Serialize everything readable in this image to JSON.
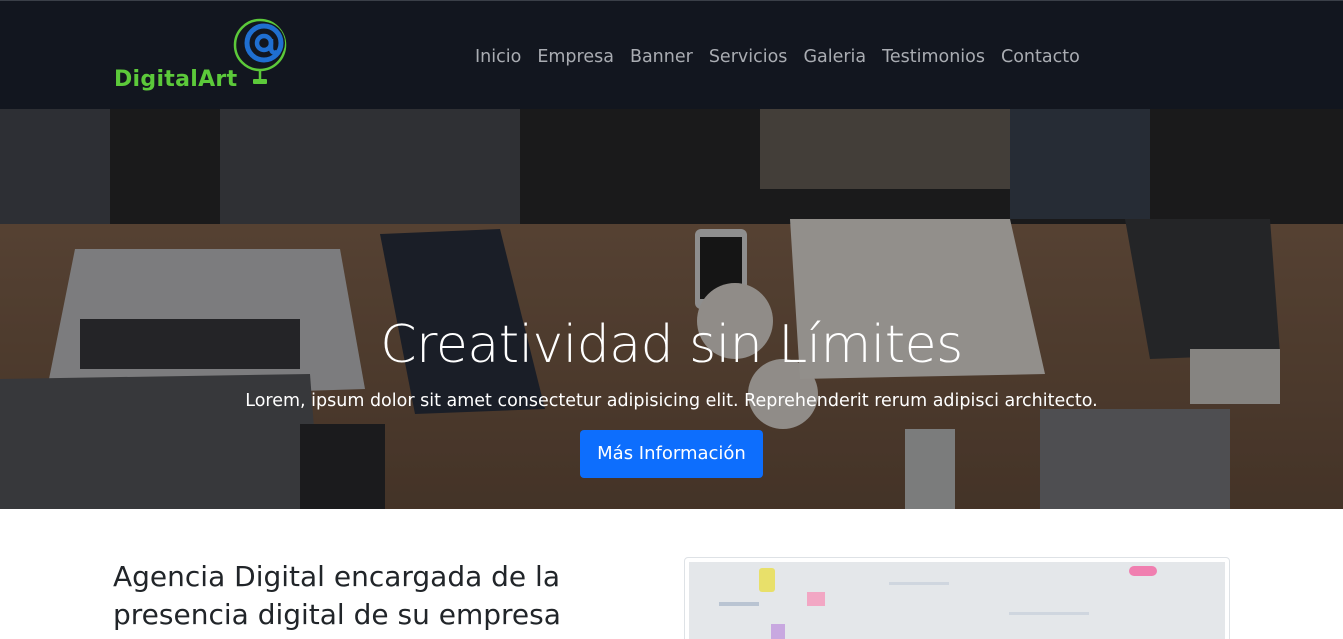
{
  "brand": {
    "name": "DigitalArt"
  },
  "nav": {
    "items": [
      "Inicio",
      "Empresa",
      "Banner",
      "Servicios",
      "Galeria",
      "Testimonios",
      "Contacto"
    ]
  },
  "hero": {
    "title": "Creatividad sin Límites",
    "subtitle": "Lorem, ipsum dolor sit amet consectetur adipisicing elit. Reprehenderit rerum adipisci architecto.",
    "button_label": "Más Información"
  },
  "about": {
    "title": "Agencia Digital encargada de la presencia digital de su empresa"
  },
  "colors": {
    "navbar_bg": "#12161f",
    "brand_green": "#5cc93a",
    "brand_blue": "#1f6fd1",
    "button_blue": "#0d6efd",
    "nav_text": "#a9acb2"
  },
  "icons": [
    "at-sign-globe-logo-icon"
  ]
}
